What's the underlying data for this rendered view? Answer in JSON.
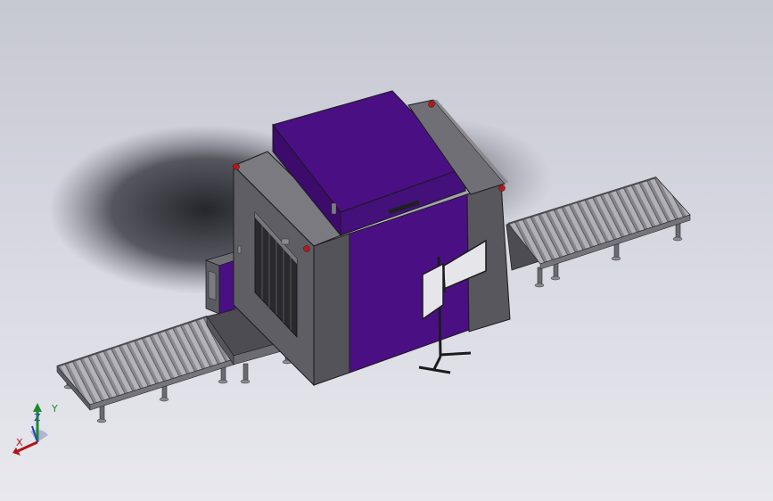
{
  "scene": {
    "name": "xray-baggage-scanner-assembly",
    "body_color": "#4b0f84",
    "frame_color": "#5c5c62",
    "background_top": "#c6c8d2",
    "background_bottom": "#e8e8ee"
  },
  "triad": {
    "x_label": "X",
    "y_label": "Y",
    "z_label": "Z",
    "x_color": "#b0151a",
    "y_color": "#1b8a2c",
    "z_color": "#2b43b0"
  }
}
